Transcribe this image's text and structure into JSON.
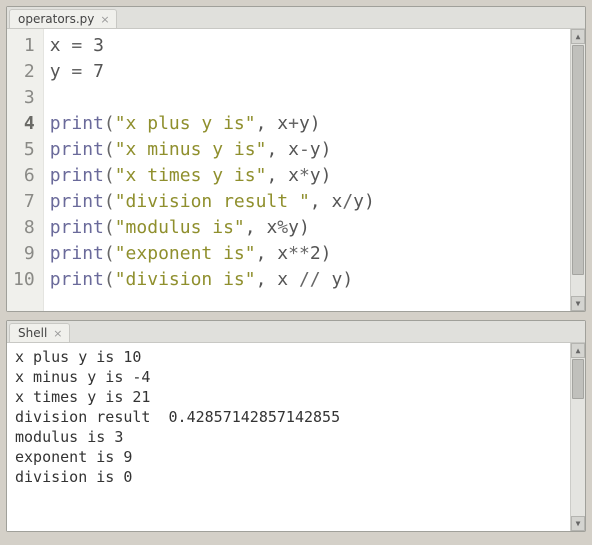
{
  "editor": {
    "tab_label": "operators.py",
    "line_numbers": [
      "1",
      "2",
      "3",
      "4",
      "5",
      "6",
      "7",
      "8",
      "9",
      "10"
    ],
    "current_line": 4,
    "lines": [
      {
        "tokens": [
          {
            "t": "x ",
            "c": "var"
          },
          {
            "t": "=",
            "c": "op"
          },
          {
            "t": " ",
            "c": "var"
          },
          {
            "t": "3",
            "c": "num"
          }
        ]
      },
      {
        "tokens": [
          {
            "t": "y ",
            "c": "var"
          },
          {
            "t": "=",
            "c": "op"
          },
          {
            "t": " ",
            "c": "var"
          },
          {
            "t": "7",
            "c": "num"
          }
        ]
      },
      {
        "tokens": [
          {
            "t": "",
            "c": "var"
          }
        ]
      },
      {
        "tokens": [
          {
            "t": "print",
            "c": "fn"
          },
          {
            "t": "(",
            "c": "op"
          },
          {
            "t": "\"x plus y is\"",
            "c": "str"
          },
          {
            "t": ", x",
            "c": "var"
          },
          {
            "t": "+",
            "c": "op"
          },
          {
            "t": "y)",
            "c": "var"
          }
        ]
      },
      {
        "tokens": [
          {
            "t": "print",
            "c": "fn"
          },
          {
            "t": "(",
            "c": "op"
          },
          {
            "t": "\"x minus y is\"",
            "c": "str"
          },
          {
            "t": ", x",
            "c": "var"
          },
          {
            "t": "-",
            "c": "op"
          },
          {
            "t": "y)",
            "c": "var"
          }
        ]
      },
      {
        "tokens": [
          {
            "t": "print",
            "c": "fn"
          },
          {
            "t": "(",
            "c": "op"
          },
          {
            "t": "\"x times y is\"",
            "c": "str"
          },
          {
            "t": ", x",
            "c": "var"
          },
          {
            "t": "*",
            "c": "op"
          },
          {
            "t": "y)",
            "c": "var"
          }
        ]
      },
      {
        "tokens": [
          {
            "t": "print",
            "c": "fn"
          },
          {
            "t": "(",
            "c": "op"
          },
          {
            "t": "\"division result \"",
            "c": "str"
          },
          {
            "t": ", x",
            "c": "var"
          },
          {
            "t": "/",
            "c": "op"
          },
          {
            "t": "y)",
            "c": "var"
          }
        ]
      },
      {
        "tokens": [
          {
            "t": "print",
            "c": "fn"
          },
          {
            "t": "(",
            "c": "op"
          },
          {
            "t": "\"modulus is\"",
            "c": "str"
          },
          {
            "t": ", x",
            "c": "var"
          },
          {
            "t": "%",
            "c": "op"
          },
          {
            "t": "y)",
            "c": "var"
          }
        ]
      },
      {
        "tokens": [
          {
            "t": "print",
            "c": "fn"
          },
          {
            "t": "(",
            "c": "op"
          },
          {
            "t": "\"exponent is\"",
            "c": "str"
          },
          {
            "t": ", x",
            "c": "var"
          },
          {
            "t": "**",
            "c": "op"
          },
          {
            "t": "2",
            "c": "num"
          },
          {
            "t": ")",
            "c": "var"
          }
        ]
      },
      {
        "tokens": [
          {
            "t": "print",
            "c": "fn"
          },
          {
            "t": "(",
            "c": "op"
          },
          {
            "t": "\"division is\"",
            "c": "str"
          },
          {
            "t": ", x ",
            "c": "var"
          },
          {
            "t": "//",
            "c": "op"
          },
          {
            "t": " y)",
            "c": "var"
          }
        ]
      }
    ]
  },
  "shell": {
    "tab_label": "Shell",
    "output": [
      "x plus y is 10",
      "x minus y is -4",
      "x times y is 21",
      "division result  0.42857142857142855",
      "modulus is 3",
      "exponent is 9",
      "division is 0"
    ]
  },
  "colors": {
    "bg": "#d4d0c8",
    "keyword": "#6a6a9a",
    "string": "#8f8f2d"
  }
}
